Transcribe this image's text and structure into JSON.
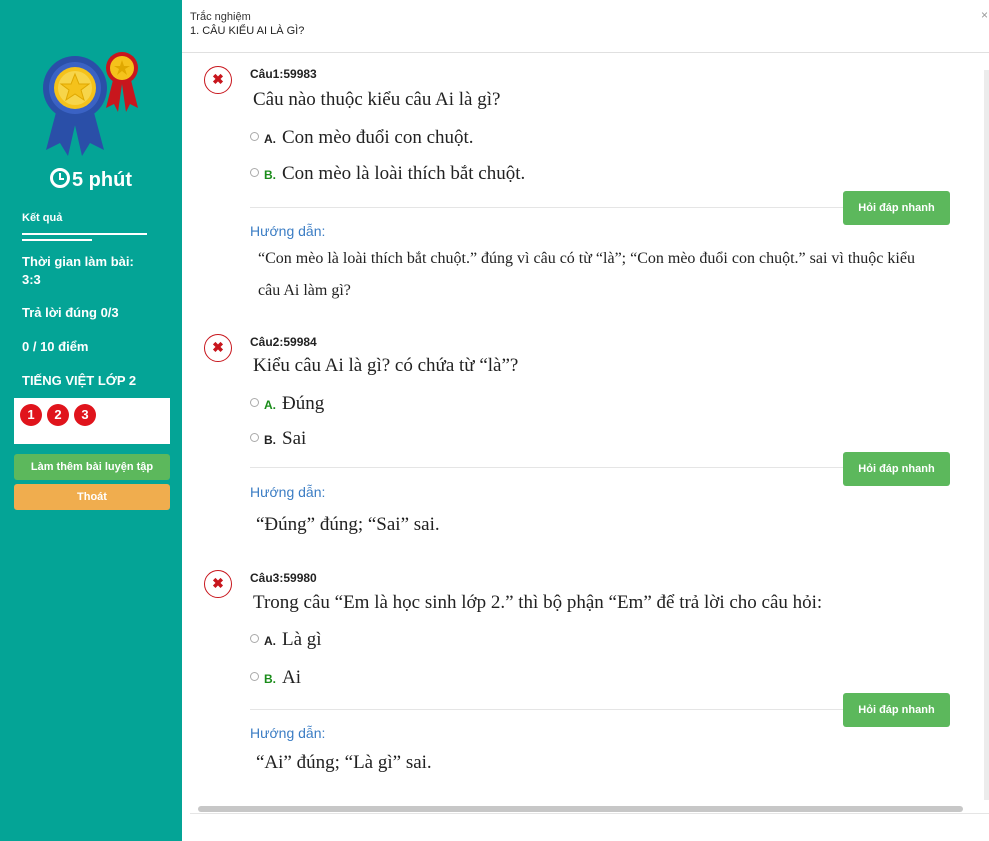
{
  "header": {
    "title": "Trắc nghiệm",
    "subtitle": "1. CÂU KIỂU AI LÀ GÌ?",
    "close_label": "×"
  },
  "sidebar": {
    "timer": "5 phút",
    "result_label": "Kết quả",
    "time_label": "Thời gian làm bài:",
    "time_value": "3:3",
    "correct": "Trả lời đúng 0/3",
    "score": "0 / 10 điểm",
    "subject": "TIẾNG VIỆT LỚP 2",
    "question_numbers": [
      "1",
      "2",
      "3"
    ],
    "more_practice": "Làm thêm bài luyện tập",
    "exit": "Thoát"
  },
  "questions": [
    {
      "id": "Câu1:59983",
      "text": "Câu nào thuộc kiểu câu Ai là gì?",
      "options": [
        {
          "letter": "A.",
          "text": "Con mèo đuổi con chuột.",
          "correct": false
        },
        {
          "letter": "B.",
          "text": "Con mèo là loài thích bắt chuột.",
          "correct": true
        }
      ],
      "quick_answer": "Hỏi đáp nhanh",
      "guide_label": "Hướng dẫn:",
      "explanation_line1": "“Con mèo là loài thích bắt chuột.” đúng vì câu có từ “là”; “Con mèo đuổi con chuột.” sai vì thuộc kiểu",
      "explanation_line2": "câu Ai làm gì?"
    },
    {
      "id": "Câu2:59984",
      "text": "Kiểu câu Ai là gì? có chứa từ “là”?",
      "options": [
        {
          "letter": "A.",
          "text": "Đúng",
          "correct": true
        },
        {
          "letter": "B.",
          "text": "Sai",
          "correct": false
        }
      ],
      "quick_answer": "Hỏi đáp nhanh",
      "guide_label": "Hướng dẫn:",
      "explanation": "“Đúng” đúng; “Sai” sai."
    },
    {
      "id": "Câu3:59980",
      "text": "Trong câu “Em là học sinh lớp 2.” thì bộ phận “Em” để trả lời cho câu hỏi:",
      "options": [
        {
          "letter": "A.",
          "text": "Là gì",
          "correct": false
        },
        {
          "letter": "B.",
          "text": "Ai",
          "correct": true
        }
      ],
      "quick_answer": "Hỏi đáp nhanh",
      "guide_label": "Hướng dẫn:",
      "explanation": "“Ai” đúng; “Là gì” sai."
    }
  ],
  "colors": {
    "sidebar_bg": "#04a496",
    "wrong_mark": "#c8161d",
    "correct_letter": "#1a8c1a",
    "guide_link": "#3b7dc4",
    "button_green": "#5cb85c",
    "button_orange": "#f0ad4e",
    "question_number_bg": "#e0141c"
  },
  "icons": {
    "medal": "award-medal-icon",
    "timer": "clock-icon",
    "wrong": "x-mark-icon",
    "radio": "radio-icon"
  }
}
